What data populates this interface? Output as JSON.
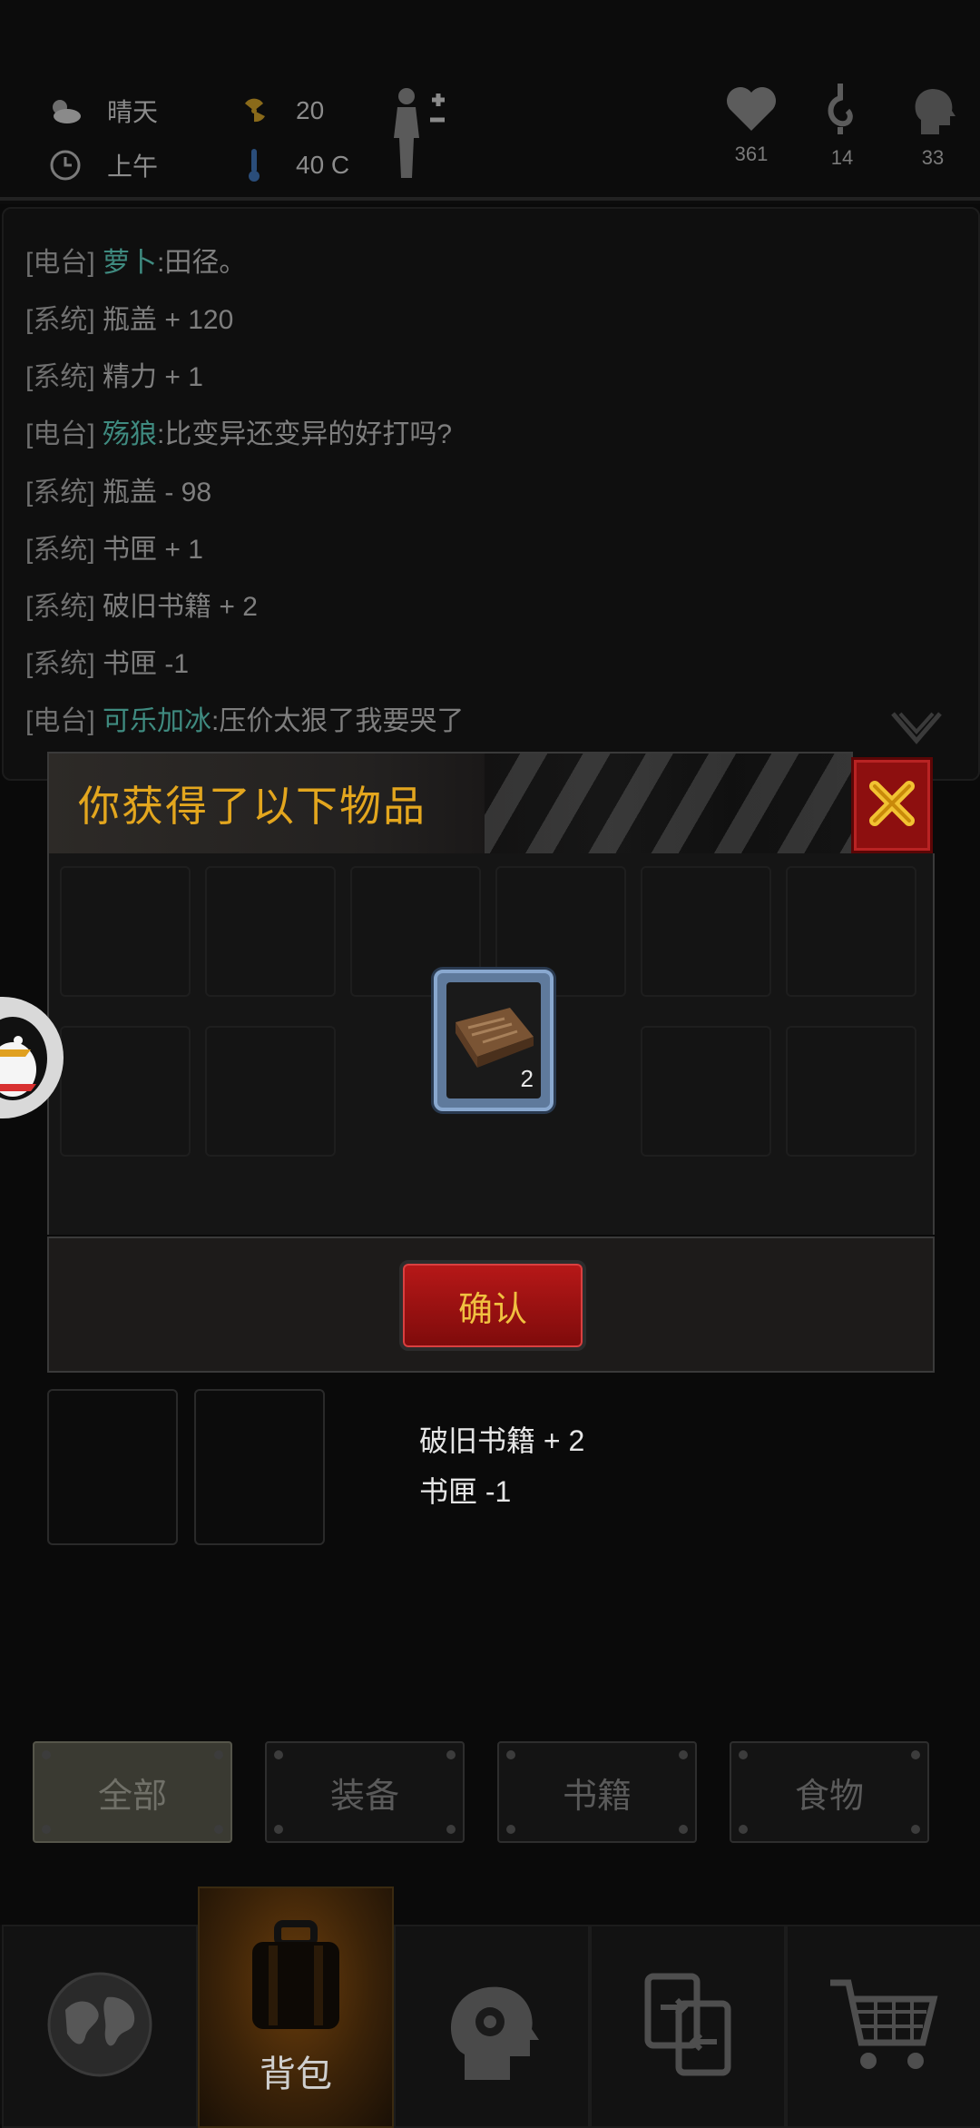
{
  "status": {
    "weather": "晴天",
    "time_of_day": "上午",
    "radiation": "20",
    "temperature": "40 C",
    "health": "361",
    "hunger": "14",
    "mood": "33"
  },
  "log": [
    {
      "tag": "[电台]",
      "nick": "萝卜",
      "text": ":田径。"
    },
    {
      "tag": "[系统]",
      "nick": "",
      "text": "瓶盖 + 120"
    },
    {
      "tag": "[系统]",
      "nick": "",
      "text": "精力 + 1"
    },
    {
      "tag": "[电台]",
      "nick": "殇狼",
      "text": ":比变异还变异的好打吗?"
    },
    {
      "tag": "[系统]",
      "nick": "",
      "text": "瓶盖 - 98"
    },
    {
      "tag": "[系统]",
      "nick": "",
      "text": "书匣 + 1"
    },
    {
      "tag": "[系统]",
      "nick": "",
      "text": "破旧书籍 + 2"
    },
    {
      "tag": "[系统]",
      "nick": "",
      "text": "书匣 -1"
    },
    {
      "tag": "[电台]",
      "nick": "可乐加冰",
      "text": ":压价太狠了我要哭了"
    }
  ],
  "dialog": {
    "title": "你获得了以下物品",
    "item_count": "2",
    "item_icon": "old-book-icon",
    "confirm_label": "确认"
  },
  "results": [
    "破旧书籍 + 2",
    "书匣 -1"
  ],
  "filters": [
    {
      "label": "全部",
      "active": true
    },
    {
      "label": "装备",
      "active": false
    },
    {
      "label": "书籍",
      "active": false
    },
    {
      "label": "食物",
      "active": false
    }
  ],
  "nav": [
    {
      "label": "",
      "icon": "world-map-icon"
    },
    {
      "label": "背包",
      "icon": "backpack-icon"
    },
    {
      "label": "",
      "icon": "head-gear-icon"
    },
    {
      "label": "",
      "icon": "trade-icon"
    },
    {
      "label": "",
      "icon": "shopping-cart-icon"
    }
  ],
  "colors": {
    "accent_title": "#e3a61e",
    "confirm_red": "#b71818",
    "nick_teal": "#3f8b80",
    "item_frame": "#89a8cf"
  }
}
